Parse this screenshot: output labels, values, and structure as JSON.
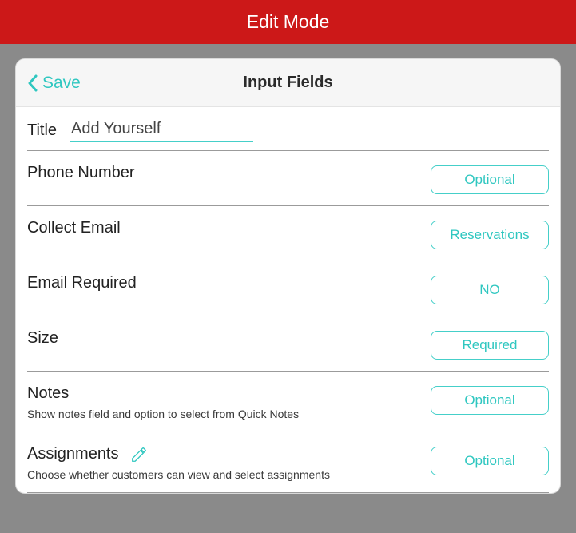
{
  "banner": {
    "title": "Edit Mode"
  },
  "header": {
    "back_label": "Save",
    "title": "Input Fields"
  },
  "title_row": {
    "label": "Title",
    "value": "Add Yourself"
  },
  "fields": {
    "phone": {
      "label": "Phone Number",
      "value": "Optional"
    },
    "email_collect": {
      "label": "Collect Email",
      "value": "Reservations"
    },
    "email_required": {
      "label": "Email Required",
      "value": "NO"
    },
    "size": {
      "label": "Size",
      "value": "Required"
    },
    "notes": {
      "label": "Notes",
      "sub": "Show notes field and option to select from Quick Notes",
      "value": "Optional"
    },
    "assignments": {
      "label": "Assignments",
      "sub": "Choose whether customers can view and select assignments",
      "value": "Optional"
    }
  }
}
